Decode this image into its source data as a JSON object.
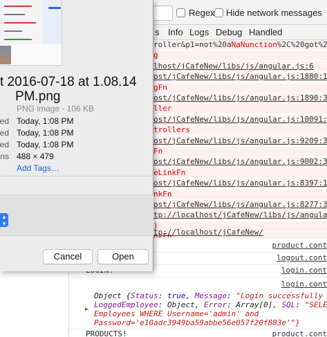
{
  "filter_bar": {
    "regex_label": "Regex",
    "hide_network_label": "Hide network messages"
  },
  "levels": [
    "s",
    "Info",
    "Logs",
    "Debug",
    "Handled"
  ],
  "error_lines": [
    {
      "kind": "mixed",
      "pre": "roller&p1=not%20a",
      "red": "NaNunction",
      "post": "%2C%20got%20"
    },
    {
      "kind": "red",
      "text": "g"
    },
    {
      "kind": "link",
      "text": "lhost/jCafeNew/libs/js/angular.js:6"
    },
    {
      "kind": "link",
      "text": "ost/jCafeNew/libs/js/angular.js:1880:1"
    },
    {
      "kind": "red",
      "text": "gFn"
    },
    {
      "kind": "link",
      "text": "ost/jCafeNew/libs/js/angular.js:1890:3"
    },
    {
      "kind": "red",
      "text": "ller"
    },
    {
      "kind": "link",
      "text": "ost/jCafeNew/libs/js/angular.js:10091:9"
    },
    {
      "kind": "red",
      "text": "trollers"
    },
    {
      "kind": "link",
      "text": "ost/jCafeNew/libs/js/angular.js:9209:34"
    },
    {
      "kind": "red",
      "text": "Fn"
    },
    {
      "kind": "link",
      "text": "ost/jCafeNew/libs/js/angular.js:9002:32"
    },
    {
      "kind": "red",
      "text": "eLinkFn"
    },
    {
      "kind": "link",
      "text": "ost/jCafeNew/libs/js/angular.js:8397:13"
    },
    {
      "kind": "red",
      "text": "nkFn"
    },
    {
      "kind": "link",
      "text": "ost/jCafeNew/libs/js/angular.js:8277:30"
    },
    {
      "kind": "link",
      "text": "tp://localhost/jCafeNew/libs/js/angula"
    },
    {
      "kind": "red",
      "text": ")"
    },
    {
      "kind": "red",
      "text": "nkFn"
    },
    {
      "kind": "link",
      "text": "ost/jCafeNew/libs/js/angular.js:9694:9)"
    }
  ],
  "normal_rows": [
    {
      "link": "tp://localhost/jCafeNew/"
    },
    {
      "src": "product.cont"
    },
    {
      "src": "logout.cont"
    },
    {
      "msg": "LOGIN!",
      "src": "login.cont"
    },
    {
      "src": "login.cont"
    }
  ],
  "object_log": {
    "line1_label": "Object {",
    "k_status": "Status",
    "v_status": "true",
    "k_message": "Message",
    "v_message": "\"Login  successfully",
    "k_employee": "LoggedEmployee",
    "v_employee": "Object,",
    "k_error": "Error",
    "v_error": "Array[0],",
    "k_sql": "SQL",
    "v_sql": "\"SELE",
    "line3": "Employees WHERE Username='admin' and",
    "line4": "Password='e10adc3949ba59abbe56e057f20f883e'\"}"
  },
  "last_log": {
    "msg": "PRODUCTS!",
    "src": "product.cont"
  },
  "info_panel": {
    "title_line1": "t 2016-07-18 at 1.08.14",
    "title_line2": "PM.png",
    "kind": "PNG image - 106 KB",
    "rows": [
      {
        "key": "ted",
        "value": "Today, 1:08 PM"
      },
      {
        "key": "ied",
        "value": "Today, 1:08 PM"
      },
      {
        "key": "ned",
        "value": "Today, 1:08 PM"
      },
      {
        "key": "ons",
        "value": "488 × 479"
      }
    ],
    "add_tags": "Add Tags…",
    "cancel_label": "Cancel",
    "open_label": "Open"
  },
  "colors": {
    "error_bg": "#fff0f0",
    "error_red": "#e00000",
    "link_blue": "#1a66d1",
    "open_accent": "#2b7df5"
  }
}
